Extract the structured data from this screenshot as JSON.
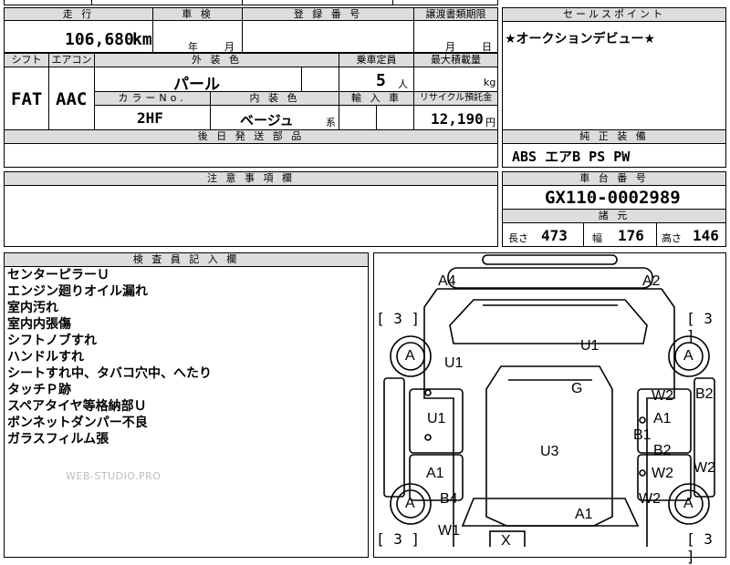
{
  "top_strip": {
    "model_partial": "",
    "model_partial_2": ""
  },
  "mileage": {
    "header": "走 行",
    "value": "106,680",
    "unit": "km"
  },
  "inspection": {
    "header": "車 検",
    "year_label": "年",
    "month_label": "月"
  },
  "registration": {
    "header": "登 録 番 号",
    "value": ""
  },
  "transfer": {
    "header": "譲渡書類期限",
    "month_label": "月",
    "day_label": "日"
  },
  "sales_point": {
    "header": "セールスポイント",
    "text": "★オークションデビュー★"
  },
  "shift": {
    "header": "シフト",
    "value": "FAT"
  },
  "ac": {
    "header": "エアコン",
    "value": "AAC"
  },
  "exterior": {
    "header": "外 装 色",
    "value": "パール"
  },
  "seating": {
    "header": "乗車定員",
    "value": "5",
    "unit": "人"
  },
  "max_load": {
    "header": "最大積載量",
    "unit": "kg"
  },
  "color_no": {
    "header": "カラーNo.",
    "value": "2HF"
  },
  "interior": {
    "header": "内 装 色",
    "value": "ベージュ",
    "suffix": "系"
  },
  "import": {
    "header": "輸 入 車"
  },
  "recycle": {
    "header": "リサイクル預託金",
    "value": "12,190",
    "unit": "円"
  },
  "later_parts": {
    "header": "後 日 発 送 部 品"
  },
  "standard_equipment": {
    "header": "純 正 装 備",
    "value": "ABS エアB PS PW"
  },
  "caution": {
    "header": "注 意 事 項 欄"
  },
  "chassis": {
    "header": "車 台 番 号",
    "value": "GX110-0002989"
  },
  "specs": {
    "header": "諸 元",
    "length_label": "長さ",
    "length": "473",
    "width_label": "幅",
    "width": "176",
    "height_label": "高さ",
    "height": "146"
  },
  "inspector": {
    "header": "検 査 員 記 入 欄",
    "lines": [
      "センターピラーＵ",
      "エンジン廻りオイル漏れ",
      "室内汚れ",
      "室内内張傷",
      "シフトノブすれ",
      "ハンドルすれ",
      "シートすれ中、タバコ穴中、へたり",
      "タッチＰ跡",
      "スペアタイヤ等格納部Ｕ",
      "ボンネットダンパー不良",
      "ガラスフィルム張"
    ],
    "watermark": "WEB-STUDIO.PRO"
  },
  "diagram": {
    "brackets": [
      "[ 3 ]",
      "[ 3 ]",
      "[ 3 ]",
      "[ 3 ]"
    ],
    "tires": [
      "A",
      "A",
      "A",
      "A"
    ],
    "marks": [
      "A4",
      "A2",
      "U1",
      "U1",
      "G",
      "W2",
      "B2",
      "U1",
      "A1",
      "B1",
      "B2",
      "U3",
      "A1",
      "W2",
      "W2",
      "B4",
      "W2",
      "A1",
      "W1",
      "X"
    ]
  }
}
